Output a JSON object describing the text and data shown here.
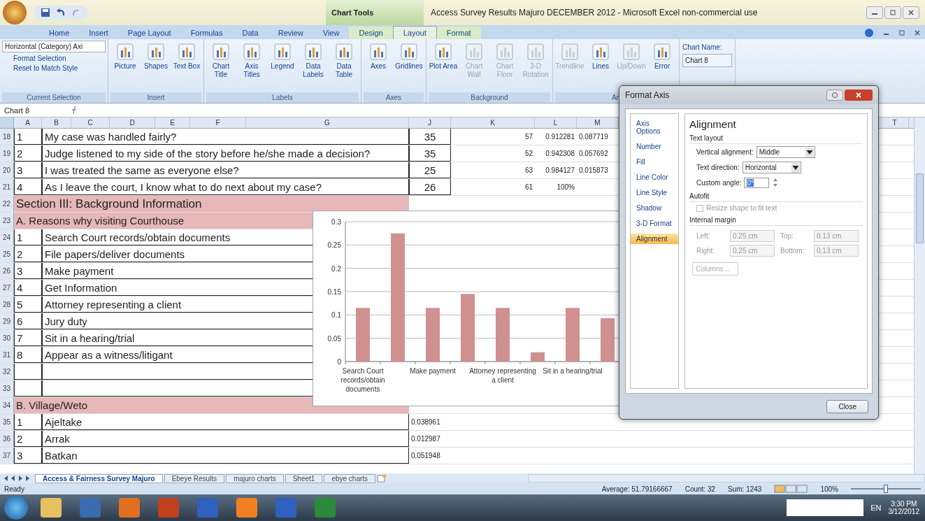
{
  "window": {
    "title": "Access Survey Results Majuro DECEMBER 2012  -  Microsoft Excel non-commercial use",
    "context_group": "Chart Tools"
  },
  "ribbon_tabs": [
    {
      "label": "Home",
      "selected": false
    },
    {
      "label": "Insert",
      "selected": false
    },
    {
      "label": "Page Layout",
      "selected": false
    },
    {
      "label": "Formulas",
      "selected": false
    },
    {
      "label": "Data",
      "selected": false
    },
    {
      "label": "Review",
      "selected": false
    },
    {
      "label": "View",
      "selected": false
    },
    {
      "label": "Design",
      "selected": false
    },
    {
      "label": "Layout",
      "selected": true
    },
    {
      "label": "Format",
      "selected": false
    }
  ],
  "current_selection": {
    "dropdown": "Horizontal (Category) Axi",
    "buttons": [
      "Format Selection",
      "Reset to Match Style"
    ],
    "label": "Current Selection"
  },
  "ribbon_groups": [
    {
      "label": "Insert",
      "buttons": [
        {
          "label": "Picture",
          "disabled": false
        },
        {
          "label": "Shapes",
          "disabled": false
        },
        {
          "label": "Text Box",
          "disabled": false
        }
      ]
    },
    {
      "label": "Labels",
      "buttons": [
        {
          "label": "Chart Title",
          "disabled": false
        },
        {
          "label": "Axis Titles",
          "disabled": false
        },
        {
          "label": "Legend",
          "disabled": false
        },
        {
          "label": "Data Labels",
          "disabled": false
        },
        {
          "label": "Data Table",
          "disabled": false
        }
      ]
    },
    {
      "label": "Axes",
      "buttons": [
        {
          "label": "Axes",
          "disabled": false
        },
        {
          "label": "Gridlines",
          "disabled": false
        }
      ]
    },
    {
      "label": "Background",
      "buttons": [
        {
          "label": "Plot Area",
          "disabled": false
        },
        {
          "label": "Chart Wall",
          "disabled": true
        },
        {
          "label": "Chart Floor",
          "disabled": true
        },
        {
          "label": "3-D Rotation",
          "disabled": true
        }
      ]
    },
    {
      "label": "An",
      "buttons": [
        {
          "label": "Trendline",
          "disabled": true
        },
        {
          "label": "Lines",
          "disabled": false
        },
        {
          "label": "Up/Down",
          "disabled": true
        },
        {
          "label": "Error",
          "disabled": false
        }
      ]
    }
  ],
  "chart_name": {
    "label": "Chart Name:",
    "value": "Chart 8"
  },
  "formula_bar": {
    "name_box": "Chart 8"
  },
  "columns": [
    "A",
    "B",
    "C",
    "D",
    "E",
    "F",
    "G",
    "J",
    "K",
    "L",
    "M",
    "T"
  ],
  "rows": [
    {
      "num": "18",
      "kind": "question",
      "number": "1",
      "text": "My case was handled fairly?",
      "count": "35",
      "k": "57",
      "l": "0.912281",
      "m": "0.087719"
    },
    {
      "num": "19",
      "kind": "question",
      "number": "2",
      "text": "Judge listened to my side of the story before he/she made a decision?",
      "count": "35",
      "k": "52",
      "l": "0.942308",
      "m": "0.057692"
    },
    {
      "num": "20",
      "kind": "question",
      "number": "3",
      "text": "I was treated the same as everyone else?",
      "count": "25",
      "k": "63",
      "l": "0.984127",
      "m": "0.015873"
    },
    {
      "num": "21",
      "kind": "question",
      "number": "4",
      "text": "As I leave the court, I know what to do next about my case?",
      "count": "26",
      "k": "61",
      "l": "100%"
    },
    {
      "num": "22",
      "kind": "section",
      "text": "Section III:   Background Information"
    },
    {
      "num": "23",
      "kind": "subsection",
      "text": "A.  Reasons why visiting Courthouse"
    },
    {
      "num": "24",
      "kind": "item",
      "number": "1",
      "text": "Search Court records/obtain documents"
    },
    {
      "num": "25",
      "kind": "item",
      "number": "2",
      "text": "File papers/deliver documents"
    },
    {
      "num": "26",
      "kind": "item",
      "number": "3",
      "text": "Make payment"
    },
    {
      "num": "27",
      "kind": "item",
      "number": "4",
      "text": "Get Information"
    },
    {
      "num": "28",
      "kind": "item",
      "number": "5",
      "text": "Attorney representing a client"
    },
    {
      "num": "29",
      "kind": "item",
      "number": "6",
      "text": "Jury duty"
    },
    {
      "num": "30",
      "kind": "item",
      "number": "7",
      "text": "Sit in a hearing/trial"
    },
    {
      "num": "31",
      "kind": "item",
      "number": "8",
      "text": "Appear as a witness/litigant"
    },
    {
      "num": "32",
      "kind": "blank"
    },
    {
      "num": "33",
      "kind": "blank"
    },
    {
      "num": "34",
      "kind": "subsection",
      "text": "B.  Village/Weto"
    },
    {
      "num": "35",
      "kind": "item",
      "number": "1",
      "text": "Ajeltake",
      "value": "0.038961"
    },
    {
      "num": "36",
      "kind": "item",
      "number": "2",
      "text": "Arrak",
      "value": "0.012987"
    },
    {
      "num": "37",
      "kind": "item",
      "number": "3",
      "text": "Batkan",
      "value": "0.051948"
    }
  ],
  "chart": {
    "chart_data": {
      "type": "bar",
      "categories": [
        "Search Court records/obtain documents",
        null,
        "Make payment",
        null,
        "Attorney representing a client",
        null,
        "Sit in a hearing/trial",
        null
      ],
      "grid": true,
      "series": [
        {
          "color": "#d09090",
          "values": [
            0.115,
            0.275,
            0.115,
            0.145,
            0.115,
            0.02,
            0.115,
            0.093
          ]
        }
      ],
      "ylim": [
        0,
        0.3
      ],
      "yticks": [
        {
          "value": 0,
          "label": "0"
        },
        0.05,
        0.1,
        0.15,
        0.2,
        0.25,
        0.3
      ]
    }
  },
  "dialog": {
    "title": "Format Axis",
    "nav": [
      {
        "label": "Axis Options",
        "selected": false
      },
      {
        "label": "Number",
        "selected": false
      },
      {
        "label": "Fill",
        "selected": false
      },
      {
        "label": "Line Color",
        "selected": false
      },
      {
        "label": "Line Style",
        "selected": false
      },
      {
        "label": "Shadow",
        "selected": false
      },
      {
        "label": "3-D Format",
        "selected": false
      },
      {
        "label": "Alignment",
        "selected": true
      }
    ],
    "heading": "Alignment",
    "text_layout": "Text layout",
    "vertical_label": "Vertical alignment:",
    "vertical_value": "Middle",
    "direction_label": "Text direction:",
    "direction_value": "Horizontal",
    "angle_label": "Custom angle:",
    "angle_value": "0°",
    "autofit": "Autofit",
    "resize": {
      "label": "Resize shape to fit text",
      "checked": false,
      "disabled": true
    },
    "margin": "Internal margin",
    "margins_disabled": true,
    "margins": [
      {
        "label": "Left:",
        "value": "0.25 cm"
      },
      {
        "label": "Top:",
        "value": "0.13 cm"
      },
      {
        "label": "Right:",
        "value": "0.25 cm"
      },
      {
        "label": "Bottom:",
        "value": "0.13 cm"
      }
    ],
    "columns_button": "Columns...",
    "close": "Close"
  },
  "sheet_tabs": [
    {
      "label": "Access & Fairness Survey Majuro",
      "selected": true
    },
    {
      "label": "Ebeye Results",
      "selected": false
    },
    {
      "label": "majuro charts",
      "selected": false
    },
    {
      "label": "Sheet1",
      "selected": false
    },
    {
      "label": "ebye charts",
      "selected": false
    }
  ],
  "status_bar": {
    "state": "Ready",
    "average": "Average: 51.79166667",
    "count": "Count: 32",
    "sum": "Sum: 1243",
    "zoom": "100%",
    "zoom_slider": {
      "level": 0.5
    }
  },
  "taskbar": {
    "language": "EN",
    "time": "3:30 PM",
    "date": "3/12/2012"
  }
}
